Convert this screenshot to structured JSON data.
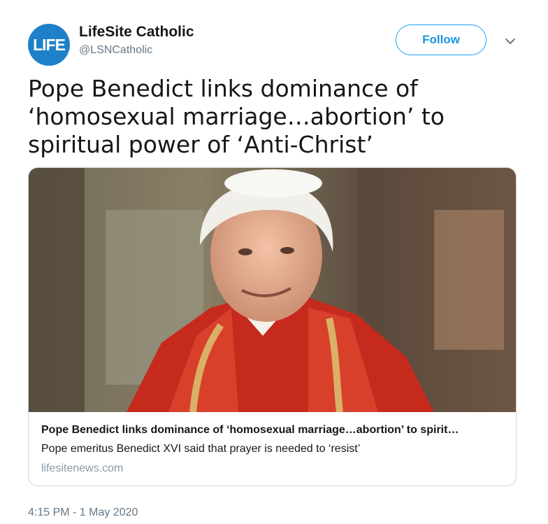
{
  "author": {
    "avatar_text": "LIFE",
    "display_name": "LifeSite Catholic",
    "handle": "@LSNCatholic"
  },
  "follow_label": "Follow",
  "tweet_text": "Pope Benedict links dominance of ‘homosexual marriage…abortion’ to spiritual power of ‘Anti-Christ’",
  "card": {
    "title": "Pope Benedict links dominance of ‘homosexual marriage…abortion’ to spirit…",
    "description": "Pope emeritus Benedict XVI said that prayer is needed to ‘resist’",
    "domain": "lifesitenews.com"
  },
  "timestamp": "4:15 PM - 1 May 2020",
  "colors": {
    "accent": "#1da1f2",
    "avatar_bg": "#1d80c8",
    "muted": "#657786",
    "border": "#ccd6dd"
  },
  "icons": [
    "chevron-down-icon"
  ]
}
